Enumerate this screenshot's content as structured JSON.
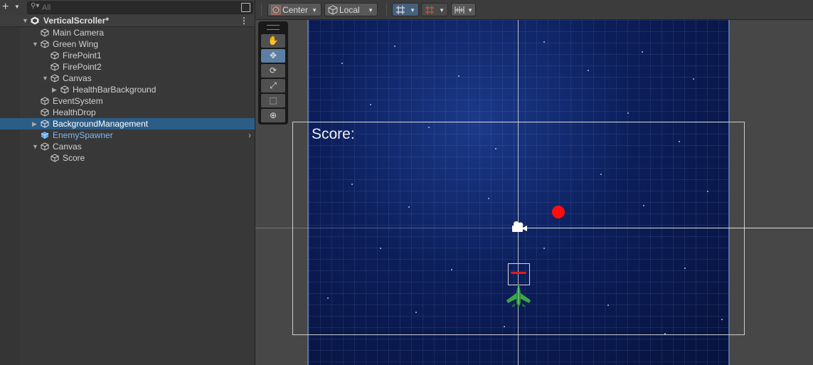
{
  "hierarchy": {
    "search_placeholder": "All",
    "scene_name": "VerticalScroller*",
    "items": [
      {
        "label": "Main Camera"
      },
      {
        "label": "Green Wing"
      },
      {
        "label": "FirePoint1"
      },
      {
        "label": "FirePoint2"
      },
      {
        "label": "Canvas"
      },
      {
        "label": "HealthBarBackground"
      },
      {
        "label": "EventSystem"
      },
      {
        "label": "HealthDrop"
      },
      {
        "label": "BackgroundManagement"
      },
      {
        "label": "EnemySpawner"
      },
      {
        "label": "Canvas"
      },
      {
        "label": "Score"
      }
    ],
    "selected": "BackgroundManagement",
    "prefab_color": "#7fb8f5",
    "selection_color": "#2c5d87"
  },
  "scene_toolbar": {
    "pivot_label": "Center",
    "space_label": "Local"
  },
  "tools": [
    "hand-tool",
    "move-tool",
    "rotate-tool",
    "scale-tool",
    "rect-tool",
    "transform-tool"
  ],
  "active_tool": "move-tool",
  "game_view": {
    "score_text": "Score:",
    "health_drop_color": "#ff0d0d",
    "background_color": "#0c1e5a"
  }
}
